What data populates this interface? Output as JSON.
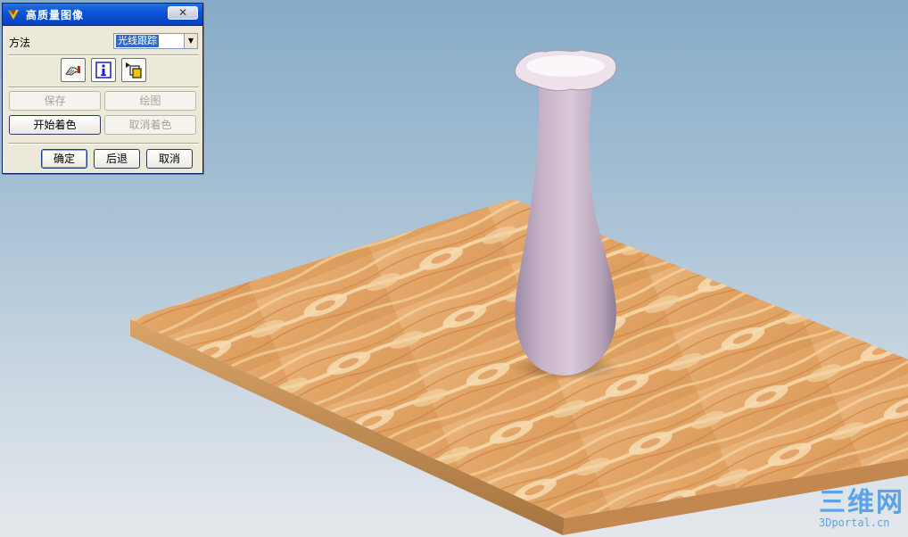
{
  "dialog": {
    "title": "高质量图像",
    "close_label": "✕",
    "method_label": "方法",
    "method_value": "光线跟踪",
    "save_label": "保存",
    "plot_label": "绘图",
    "start_shading_label": "开始着色",
    "cancel_shading_label": "取消着色",
    "ok_label": "确定",
    "back_label": "后退",
    "cancel_label": "取消"
  },
  "watermark": {
    "main": "三维网",
    "sub": "3Dportal.cn"
  },
  "colors": {
    "title_bar": "#0a55d8",
    "dialog_bg": "#ece9d8",
    "watermark": "#5aa3ea",
    "wood": "#e0a568",
    "vase": "#c9b6cc"
  }
}
